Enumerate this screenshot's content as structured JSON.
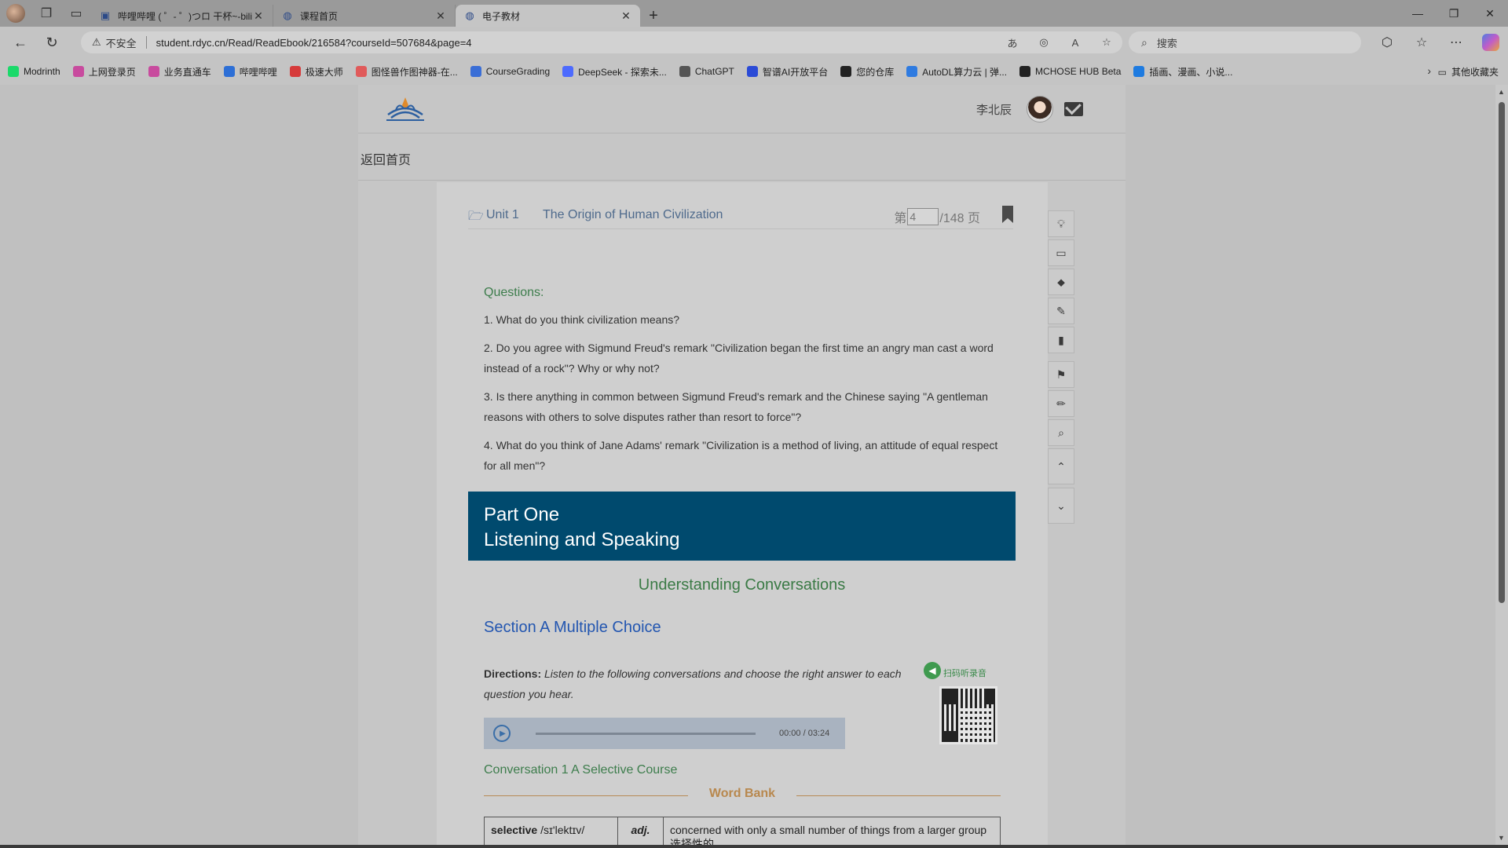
{
  "browser": {
    "tabs": [
      {
        "title": "哔哩哔哩 ( ゜- ゜)つロ 干杯~-bilibili",
        "icon": "bilibili-icon"
      },
      {
        "title": "课程首页",
        "icon": "globe-icon"
      },
      {
        "title": "电子教材",
        "icon": "globe-icon",
        "active": true
      }
    ],
    "insecure_label": "不安全",
    "url": "student.rdyc.cn/Read/ReadEbook/216584?courseId=507684&page=4",
    "search_placeholder": "搜索",
    "bookmarks": [
      {
        "label": "Modrinth",
        "color": "#1bd96a"
      },
      {
        "label": "上网登录页",
        "color": "#c84b9e"
      },
      {
        "label": "业务直通车",
        "color": "#c84b9e"
      },
      {
        "label": "哔哩哔哩",
        "color": "#2d6fd6"
      },
      {
        "label": "极速大师",
        "color": "#d63a3a"
      },
      {
        "label": "图怪兽作图神器-在...",
        "color": "#e05a5a"
      },
      {
        "label": "CourseGrading",
        "color": "#3a6ed6"
      },
      {
        "label": "DeepSeek - 探索未...",
        "color": "#4d6bfe"
      },
      {
        "label": "ChatGPT",
        "color": "#555555"
      },
      {
        "label": "智谱AI开放平台",
        "color": "#2b4bd6"
      },
      {
        "label": "您的仓库",
        "color": "#222222"
      },
      {
        "label": "AutoDL算力云 | 弹...",
        "color": "#2f7be0"
      },
      {
        "label": "MCHOSE HUB Beta",
        "color": "#222222"
      },
      {
        "label": "插画、漫画、小说...",
        "color": "#1e7be0"
      }
    ],
    "other_bookmarks": "其他收藏夹"
  },
  "site": {
    "username": "李北辰",
    "back_home": "返回首页"
  },
  "ebook": {
    "unit_no": "Unit 1",
    "unit_title": "The Origin of Human Civilization",
    "page_prefix": "第",
    "current_page": "4",
    "page_total": "/148 页",
    "questions_title": "Questions:",
    "questions": [
      "1. What do you think civilization means?",
      "2. Do you agree with Sigmund Freud's remark \"Civilization began the first time an angry man cast a word instead of a rock\"? Why or why not?",
      "3. Is there anything in common between Sigmund Freud's remark and the Chinese saying \"A gentleman reasons with others to solve disputes rather than resort to force\"?",
      "4. What do you think of Jane Adams' remark \"Civilization is a method of living, an attitude of equal respect for all men\"?"
    ],
    "part_line1": "Part One",
    "part_line2": "Listening and Speaking",
    "uc_title": "Understanding Conversations",
    "section_title": "Section A Multiple Choice",
    "directions_label": "Directions:",
    "directions_text": "Listen to the following conversations and choose the right answer to each question you hear.",
    "scan_label": "扫码听录音",
    "audio_time": "00:00 / 03:24",
    "audio_progress": 0,
    "conversation_title": "Conversation 1 A Selective Course",
    "word_bank_label": "Word Bank",
    "word_bank": [
      {
        "word": "selective",
        "phonetic": "/sɪ'lektɪv/",
        "pos": "adj.",
        "meaning": "concerned with only a small number of things from a larger group 选择性的"
      }
    ]
  },
  "colors": {
    "banner": "#004a6e",
    "green_heading": "#3d7d4c",
    "blue_heading": "#2356b0",
    "word_bank": "#b8884e"
  }
}
